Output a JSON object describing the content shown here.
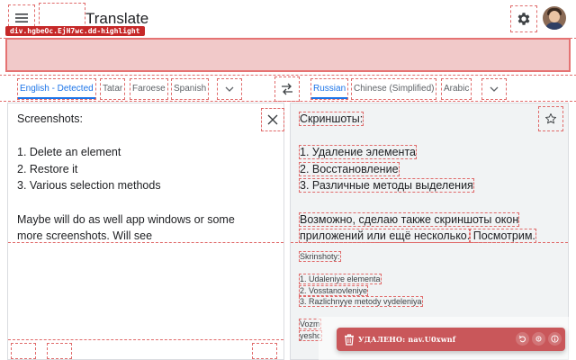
{
  "header": {
    "title": "Translate",
    "highlight_tag": "div.hgbeOc.EjH7wc.dd-highlight"
  },
  "source_languages": [
    "English - Detected",
    "Tatar",
    "Faroese",
    "Spanish"
  ],
  "target_languages": [
    "Russian",
    "Chinese (Simplified)",
    "Arabic"
  ],
  "source": {
    "lines": [
      "Screenshots:",
      "",
      "1. Delete an element",
      "2. Restore it",
      "3. Various selection methods",
      "",
      "Maybe will do as well app windows or some",
      "more screenshots. Will see"
    ]
  },
  "target": {
    "lines": [
      [
        "Скриншоты:"
      ],
      [],
      [
        "1. Удаление элемента"
      ],
      [
        "2. Восстановление"
      ],
      [
        "3. Различные методы выделения"
      ],
      [],
      [
        "Возможно, сделаю также скриншоты окон"
      ],
      [
        "приложений или ещё несколько.",
        " Посмотрим."
      ]
    ],
    "transliteration": [
      "Skrinshoty:",
      "",
      "1. Udaleniye elementa",
      "2. Vosstanovleniye",
      "3. Razlichnyye metody vydeleniya",
      "",
      "Vozm",
      "yeshc"
    ]
  },
  "toast": {
    "message": "УДАЛЕНО: nav.U0xwnf",
    "background": "#c9575a"
  },
  "colors": {
    "accent": "#1a73e8",
    "highlight": "#f1c9c9",
    "tag": "#c62828"
  },
  "icons": [
    "menu-icon",
    "settings-icon",
    "swap-icon",
    "close-icon",
    "star-icon",
    "chevron-down-icon",
    "trash-icon",
    "undo-icon",
    "gear-icon",
    "info-icon"
  ]
}
